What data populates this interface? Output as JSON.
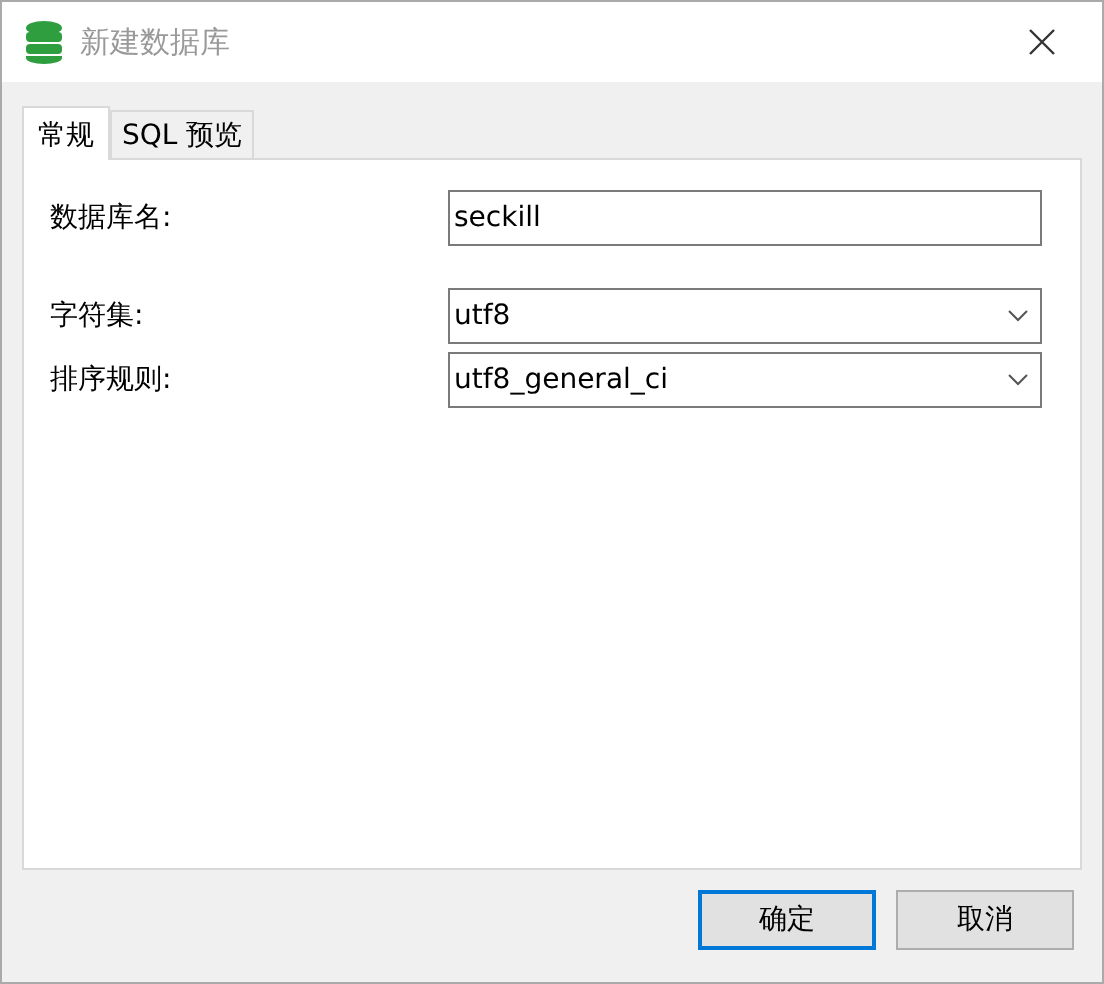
{
  "window": {
    "title": "新建数据库"
  },
  "tabs": [
    {
      "label": "常规",
      "selected": true
    },
    {
      "label": "SQL 预览",
      "selected": false
    }
  ],
  "fields": [
    {
      "kind": "text",
      "label": "数据库名:",
      "value": "seckill"
    },
    {
      "kind": "select",
      "label": "字符集:",
      "value": "utf8"
    },
    {
      "kind": "select",
      "label": "排序规则:",
      "value": "utf8_general_ci"
    }
  ],
  "buttons": [
    {
      "label": "确定",
      "selected": true
    },
    {
      "label": "取消",
      "selected": false
    }
  ]
}
